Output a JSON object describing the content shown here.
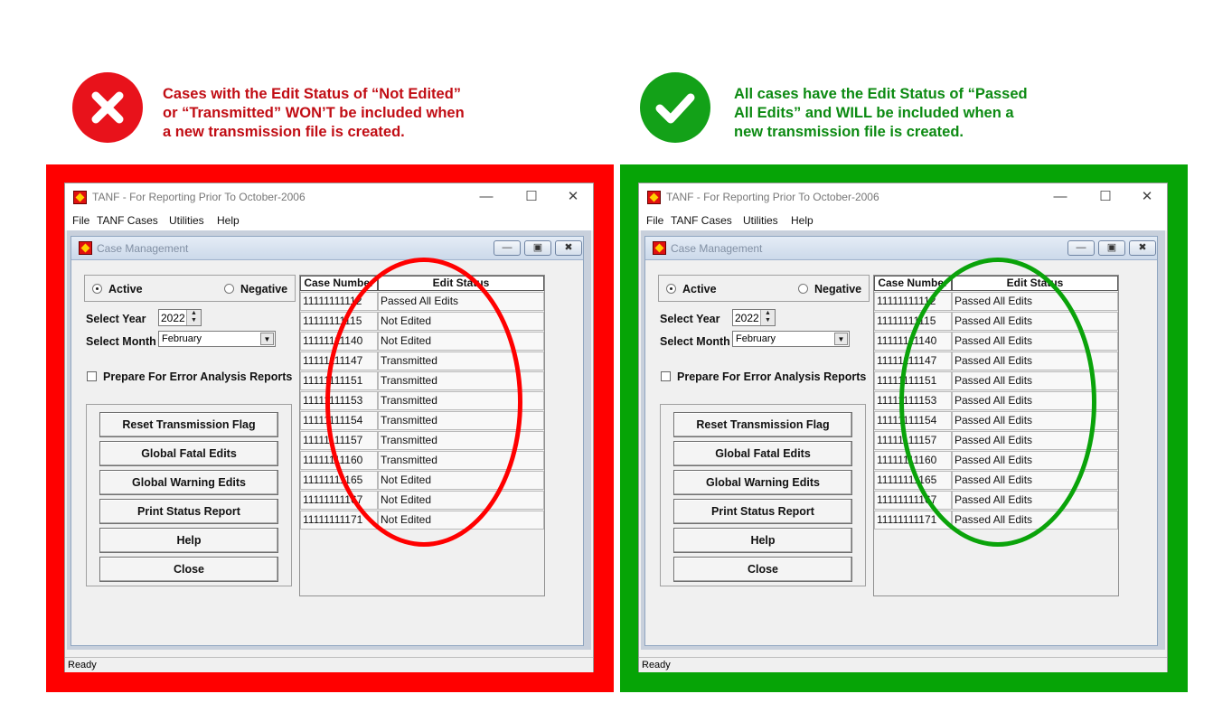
{
  "bad_caption": {
    "icon": "x-mark-icon",
    "color": "#e8121b",
    "lines": [
      "Cases with the Edit Status of “Not Edited”",
      "or “Transmitted” WON’T be included when",
      "a new transmission file is created."
    ]
  },
  "good_caption": {
    "icon": "check-mark-icon",
    "color": "#13a118",
    "lines": [
      "All cases have the Edit Status of “Passed",
      "All Edits” and WILL be included when a",
      "new transmission file is created."
    ]
  },
  "app": {
    "title": "TANF -  For Reporting  Prior To October-2006",
    "menu": [
      "File",
      "TANF Cases",
      "Utilities",
      "Help"
    ],
    "child_title": "Case Management",
    "radio_active": "Active",
    "radio_negative": "Negative",
    "year_label": "Select Year",
    "year_value": "2022",
    "month_label": "Select Month",
    "month_value": "February",
    "error_analysis_label": "Prepare For Error Analysis Reports",
    "buttons": [
      "Reset Transmission Flag",
      "Global Fatal Edits",
      "Global Warning Edits",
      "Print Status Report",
      "Help",
      "Close"
    ],
    "col_case": "Case Number",
    "col_status": "Edit Status",
    "status_bar": "Ready"
  },
  "left_table": [
    {
      "case": "11111111112",
      "status": "Passed All Edits"
    },
    {
      "case": "11111111115",
      "status": "Not Edited"
    },
    {
      "case": "11111111140",
      "status": "Not Edited"
    },
    {
      "case": "11111111147",
      "status": "Transmitted"
    },
    {
      "case": "11111111151",
      "status": "Transmitted"
    },
    {
      "case": "11111111153",
      "status": "Transmitted"
    },
    {
      "case": "11111111154",
      "status": "Transmitted"
    },
    {
      "case": "11111111157",
      "status": "Transmitted"
    },
    {
      "case": "11111111160",
      "status": "Transmitted"
    },
    {
      "case": "11111111165",
      "status": "Not Edited"
    },
    {
      "case": "11111111167",
      "status": "Not Edited"
    },
    {
      "case": "11111111171",
      "status": "Not Edited"
    }
  ],
  "right_table": [
    {
      "case": "11111111112",
      "status": "Passed All Edits"
    },
    {
      "case": "11111111115",
      "status": "Passed All Edits"
    },
    {
      "case": "11111111140",
      "status": "Passed All Edits"
    },
    {
      "case": "11111111147",
      "status": "Passed All Edits"
    },
    {
      "case": "11111111151",
      "status": "Passed All Edits"
    },
    {
      "case": "11111111153",
      "status": "Passed All Edits"
    },
    {
      "case": "11111111154",
      "status": "Passed All Edits"
    },
    {
      "case": "11111111157",
      "status": "Passed All Edits"
    },
    {
      "case": "11111111160",
      "status": "Passed All Edits"
    },
    {
      "case": "11111111165",
      "status": "Passed All Edits"
    },
    {
      "case": "11111111167",
      "status": "Passed All Edits"
    },
    {
      "case": "11111111171",
      "status": "Passed All Edits"
    }
  ],
  "colors": {
    "bad_frame": "#ff0000",
    "good_frame": "#06a406"
  }
}
